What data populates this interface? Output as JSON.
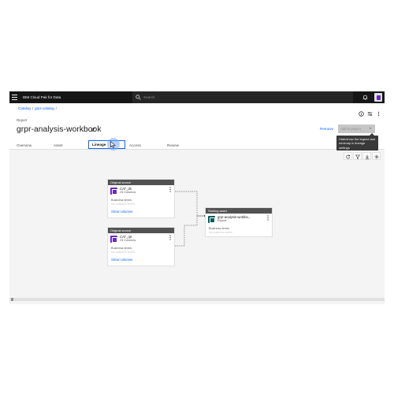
{
  "topbar": {
    "brand": "IBM Cloud Pak for Data",
    "search_placeholder": "Search"
  },
  "breadcrumb": {
    "items": [
      "Catalog",
      "grpr-catalog"
    ]
  },
  "header": {
    "type_label": "Report",
    "title": "grpr-analysis-workbook",
    "remove_label": "Remove",
    "add_to_project_label": "Add to project"
  },
  "tabs": [
    {
      "label": "Overview"
    },
    {
      "label": "Asset"
    },
    {
      "label": "Lineage"
    },
    {
      "label": "Access"
    },
    {
      "label": "Review"
    }
  ],
  "tooltip": {
    "text": "Hide/show the legend and minimap in lineage settings"
  },
  "lineage": {
    "cards": [
      {
        "header": "Original source",
        "name": "CAT_ds",
        "subtitle": "23 Columns",
        "terms_label": "Business terms",
        "terms_value": "No business terms",
        "link": "Show columns"
      },
      {
        "header": "Original source",
        "name": "CAT_rpt",
        "subtitle": "23 Columns",
        "terms_label": "Business terms",
        "terms_value": "No business terms",
        "link": "Show columns"
      },
      {
        "header": "Starting asset",
        "name": "grpr-analysis-workbo...",
        "subtitle": "Report",
        "terms_label": "Business terms",
        "terms_value": "No business terms"
      }
    ]
  },
  "colors": {
    "accent": "#0f62fe",
    "topbar": "#161616",
    "canvas": "#f4f4f4",
    "asset_icon": "#6929c4",
    "report_icon": "#005d5d"
  }
}
